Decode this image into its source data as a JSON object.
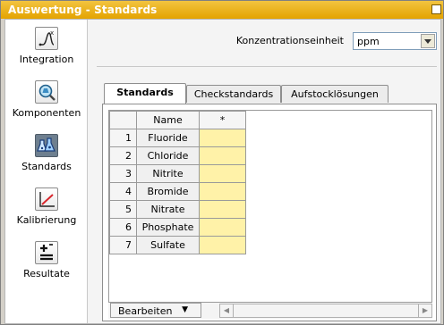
{
  "window": {
    "title": "Auswertung - Standards"
  },
  "sidebar": {
    "items": [
      {
        "label": "Integration",
        "icon": "integration-peak-icon"
      },
      {
        "label": "Komponenten",
        "icon": "magnifier-flask-icon"
      },
      {
        "label": "Standards",
        "icon": "flasks-icon"
      },
      {
        "label": "Kalibrierung",
        "icon": "calibration-curve-icon"
      },
      {
        "label": "Resultate",
        "icon": "plus-equals-icon"
      }
    ],
    "active": "Standards"
  },
  "unit": {
    "label": "Konzentrationseinheit",
    "value": "ppm"
  },
  "tabs": [
    {
      "label": "Standards",
      "active": true
    },
    {
      "label": "Checkstandards",
      "active": false
    },
    {
      "label": "Aufstocklösungen",
      "active": false
    }
  ],
  "grid": {
    "headers": {
      "name": "Name",
      "value": "*"
    },
    "rows": [
      {
        "num": "1",
        "name": "Fluoride"
      },
      {
        "num": "2",
        "name": "Chloride"
      },
      {
        "num": "3",
        "name": "Nitrite"
      },
      {
        "num": "4",
        "name": "Bromide"
      },
      {
        "num": "5",
        "name": "Nitrate"
      },
      {
        "num": "6",
        "name": "Phosphate"
      },
      {
        "num": "7",
        "name": "Sulfate"
      }
    ]
  },
  "bottom": {
    "edit_label": "Bearbeiten"
  },
  "colors": {
    "title_bar": "#e9ad0c",
    "value_cell": "#fff2a8",
    "active_icon_bg": "#6e7f8f"
  }
}
